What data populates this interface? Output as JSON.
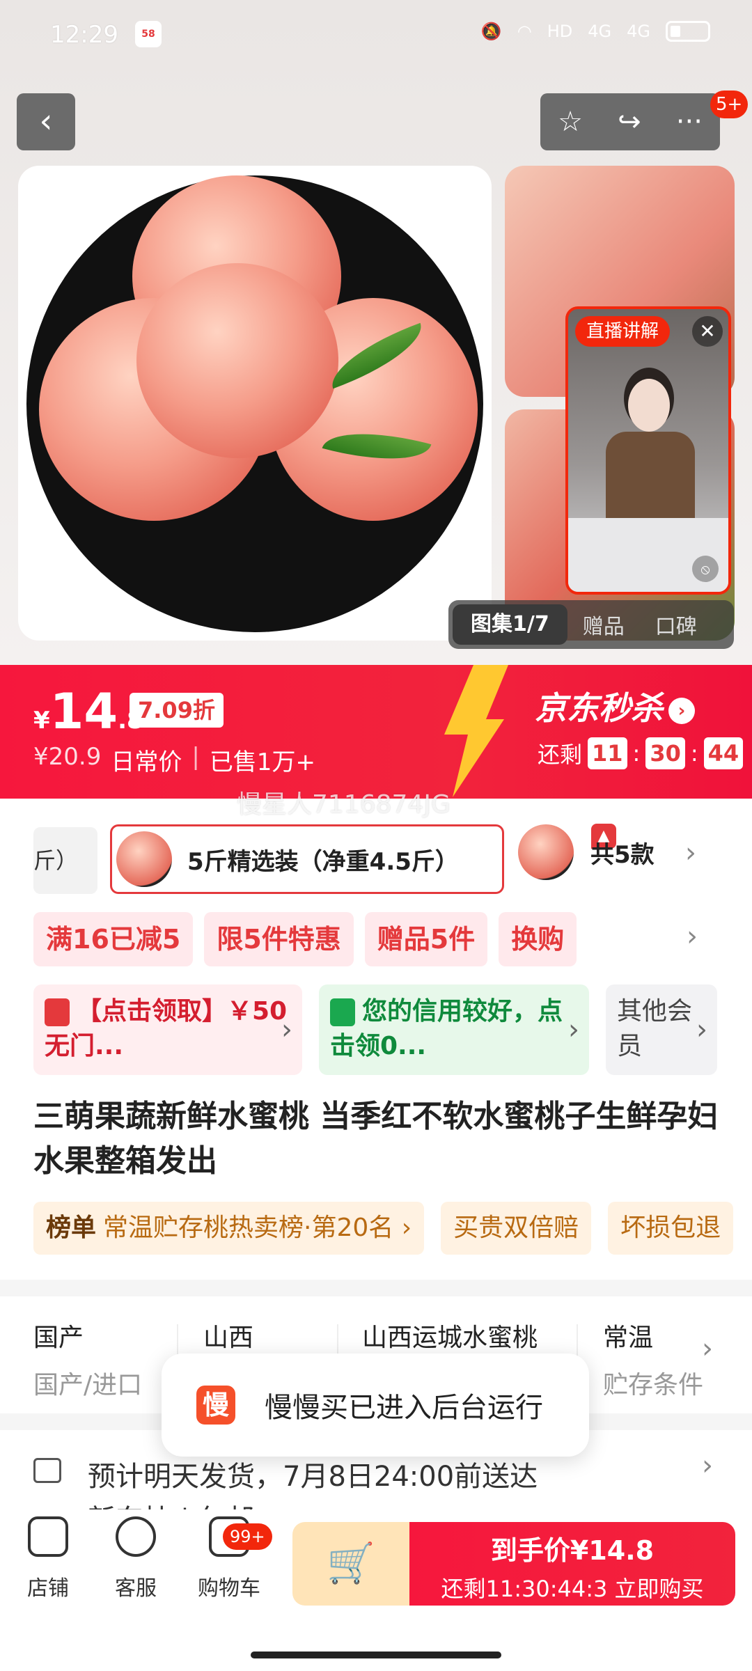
{
  "status_bar": {
    "time": "12:29",
    "app_logo": "58",
    "icons": [
      "mute-icon",
      "wifi-icon",
      "hd-icon",
      "signal-4g-icon",
      "signal-4g-icon",
      "battery-icon"
    ],
    "hd": "HD",
    "net1": "4G",
    "net2": "4G"
  },
  "nav": {
    "back": "‹",
    "favorite": "☆",
    "share": "↪",
    "more": "···",
    "more_badge": "5+"
  },
  "gallery": {
    "live_badge": "直播讲解",
    "close": "✕",
    "mute": "⦸",
    "tabs": {
      "active": "图集1/7",
      "gift": "赠品",
      "reviews": "口碑"
    }
  },
  "price": {
    "currency": "¥",
    "integer": "14",
    "decimal": ".8",
    "discount": "7.09折",
    "original": "¥20.9",
    "original_label": "日常价",
    "separator": "|",
    "sold": "已售1万+",
    "seckill_title": "京东秒杀",
    "seckill_arrow": "›",
    "countdown_label": "还剩",
    "hh": "11",
    "mm": "30",
    "ss": "44",
    "colon": ":",
    "accent": "#f2233c"
  },
  "watermark": "慢星人7116874JG",
  "variants": {
    "prev_label": "斤）",
    "selected": "5斤精选装（净重4.5斤）",
    "flame": "▲",
    "other_count": "共5款",
    "arrow": "›"
  },
  "promos": [
    "满16已减5",
    "限5件特惠",
    "赠品5件",
    "换购"
  ],
  "promo_arrow": "›",
  "coupons": [
    {
      "text": "【点击领取】￥50无门...",
      "icon": "coupon-icon"
    },
    {
      "text": "您的信用较好，点击领0...",
      "icon": "shopping-bag-icon"
    },
    {
      "text": "其他会员"
    }
  ],
  "coupon_arrow": "›",
  "title": "三萌果蔬新鲜水蜜桃 当季红不软水蜜桃子生鲜孕妇水果整箱发出",
  "rank": {
    "label": "榜单",
    "text": "常温贮存桃热卖榜·第20名 ›",
    "guarantee1": "买贵双倍赔",
    "guarantee2": "坏损包退"
  },
  "specs": [
    {
      "value": "国产",
      "key": "国产/进口"
    },
    {
      "value": "山西",
      "key": ""
    },
    {
      "value": "山西运城水蜜桃",
      "key": ""
    },
    {
      "value": "常温",
      "key": "贮存条件"
    }
  ],
  "spec_arrow": "›",
  "toast": {
    "icon": "慢",
    "text": "慢慢买已进入后台运行"
  },
  "shipping": {
    "line1": "预计明天发货，7月8日24:00前送达",
    "line2": "新东桂 | 包邮",
    "arrow": "›"
  },
  "bottom_bar": {
    "shop": "店铺",
    "service": "客服",
    "cart": "购物车",
    "cart_badge": "99+",
    "add_cart_icon": "🛒",
    "buy_line1": "到手价¥14.8",
    "buy_line2": "还剩11:30:44:3 立即购买"
  }
}
